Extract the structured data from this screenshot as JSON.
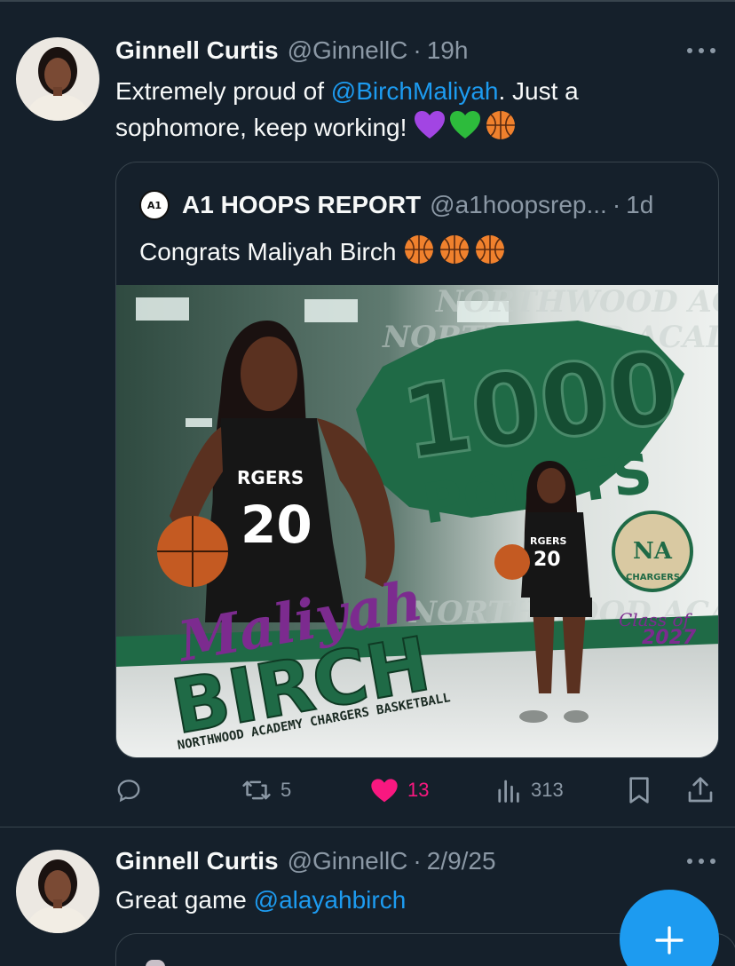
{
  "tweets": [
    {
      "author_name": "Ginnell Curtis",
      "author_handle": "@GinnellC",
      "dot": "·",
      "time": "19h",
      "text_before": "Extremely proud of ",
      "mention": "@BirchMaliyah",
      "text_after": ". Just a sophomore,  keep working! ",
      "emojis": [
        "purple-heart",
        "green-heart",
        "basketball"
      ],
      "quote": {
        "author_name": "A1 HOOPS REPORT",
        "author_handle": "@a1hoopsrep...",
        "dot": "·",
        "time": "1d",
        "avatar_text": "A1",
        "text": "Congrats Maliyah Birch ",
        "emojis": [
          "basketball",
          "basketball",
          "basketball"
        ],
        "graphic": {
          "big_number": "1000",
          "points_word": "POINTS",
          "first_name": "Maliyah",
          "last_name": "BIRCH",
          "team_line": "NORTHWOOD ACADEMY CHARGERS BASKETBALL",
          "class_label": "Class of",
          "class_year": "2027",
          "jersey_text": "RGERS",
          "jersey_number": "20",
          "logo_letters": "NA",
          "logo_text": "CHARGERS",
          "background_text": "NORTHWOOD ACADEMY CHARGERS",
          "colors": {
            "green": "#1f6a46",
            "purple": "#7c2b8f"
          }
        }
      },
      "actions": {
        "replies": "",
        "retweets": "5",
        "likes": "13",
        "views": "313",
        "liked": true
      }
    },
    {
      "author_name": "Ginnell Curtis",
      "author_handle": "@GinnellC",
      "dot": "·",
      "time": "2/9/25",
      "text_before": "Great game ",
      "mention": "@alayahbirch",
      "text_after": ""
    }
  ],
  "icons": {
    "more": "more-horizontal-icon",
    "reply": "reply-icon",
    "retweet": "retweet-icon",
    "like": "heart-icon",
    "views": "views-icon",
    "bookmark": "bookmark-icon",
    "share": "share-icon",
    "compose": "plus-icon"
  },
  "colors": {
    "background": "#15202b",
    "accent": "#1d9bf0",
    "like": "#f91880",
    "secondary_text": "#8b98a5",
    "border": "#38444d"
  }
}
